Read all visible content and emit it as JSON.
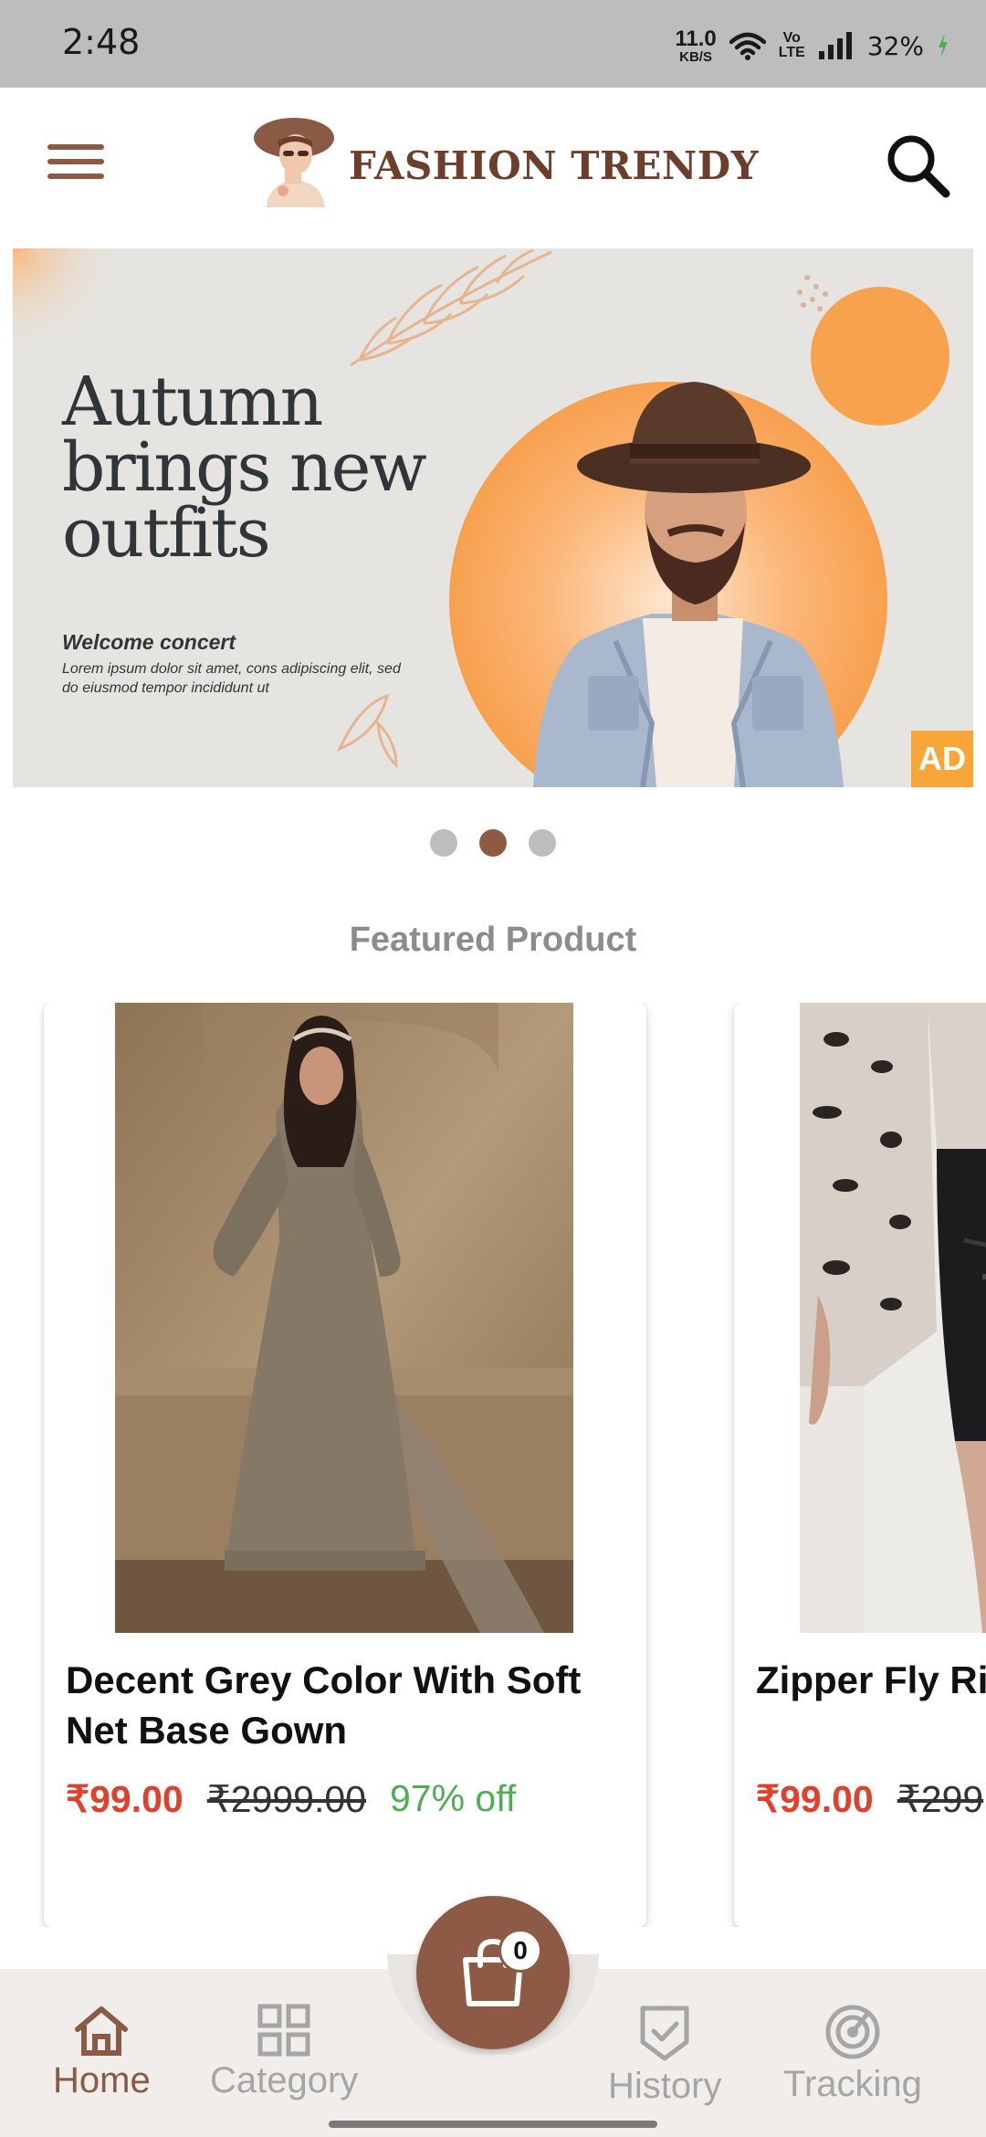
{
  "status_bar": {
    "time": "2:48",
    "net_speed_value": "11.0",
    "net_speed_unit": "KB/S",
    "volte_top": "Vo",
    "volte_bottom": "LTE",
    "battery": "32%"
  },
  "header": {
    "brand": "FASHION TRENDY",
    "menu_icon": "hamburger-menu-icon",
    "search_icon": "search-icon"
  },
  "banner": {
    "headline": "Autumn brings new outfits",
    "sub_title": "Welcome concert",
    "sub_text": "Lorem ipsum dolor sit amet, cons adipiscing elit, sed do eiusmod tempor incididunt ut",
    "badge": "AD",
    "accent_color": "#f7a637",
    "active_slide": 2,
    "slide_count": 3
  },
  "featured": {
    "title": "Featured Product",
    "products": [
      {
        "name": "Decent Grey Color With Soft Net Base Gown",
        "price": "₹99.00",
        "original_price": "₹2999.00",
        "discount": "97% off"
      },
      {
        "name": "Zipper Fly Ri Hem Denim S",
        "price": "₹99.00",
        "original_price": "₹299"
      }
    ]
  },
  "bottom_nav": {
    "items": [
      {
        "label": "Home",
        "icon": "home-icon",
        "active": true
      },
      {
        "label": "Category",
        "icon": "grid-icon",
        "active": false
      },
      {
        "label": "History",
        "icon": "shield-check-icon",
        "active": false
      },
      {
        "label": "Tracking",
        "icon": "radar-icon",
        "active": false
      }
    ],
    "cart_count": "0",
    "cart_icon": "shopping-bag-icon",
    "accent_color": "#8a5a44"
  }
}
